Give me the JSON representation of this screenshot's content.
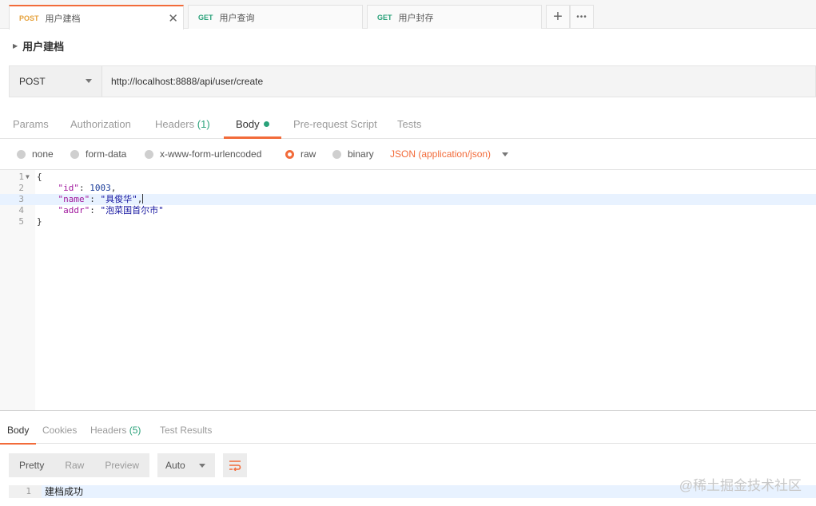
{
  "tabs": [
    {
      "method": "POST",
      "name": "用户建档"
    },
    {
      "method": "GET",
      "name": "用户查询"
    },
    {
      "method": "GET",
      "name": "用户封存"
    }
  ],
  "tab_actions": {
    "add": "+",
    "more": "•••",
    "close": "✕"
  },
  "request": {
    "name": "用户建档",
    "method": "POST",
    "url": "http://localhost:8888/api/user/create"
  },
  "request_tabs": {
    "params": "Params",
    "authorization": "Authorization",
    "headers": "Headers",
    "headers_count": "(1)",
    "body": "Body",
    "pre_request": "Pre-request Script",
    "tests": "Tests"
  },
  "body_types": {
    "none": "none",
    "form_data": "form-data",
    "urlencoded": "x-www-form-urlencoded",
    "raw": "raw",
    "binary": "binary",
    "selected": "raw",
    "content_type": "JSON (application/json)"
  },
  "editor": {
    "line_numbers": [
      "1",
      "2",
      "3",
      "4",
      "5"
    ],
    "open_brace": "{",
    "close_brace": "}",
    "fields": [
      {
        "key": "\"id\"",
        "value": "1003",
        "suffix": ","
      },
      {
        "key": "\"name\"",
        "value": "\"具俊华\"",
        "suffix": ","
      },
      {
        "key": "\"addr\"",
        "value": "\"泡菜国首尔市\"",
        "suffix": ""
      }
    ]
  },
  "response_tabs": {
    "body": "Body",
    "cookies": "Cookies",
    "headers": "Headers",
    "headers_count": "(5)",
    "test_results": "Test Results"
  },
  "response_toolbar": {
    "pretty": "Pretty",
    "raw": "Raw",
    "preview": "Preview",
    "format": "Auto"
  },
  "response_body": {
    "line": "1",
    "text": "建档成功"
  },
  "watermark": "@稀土掘金技术社区",
  "colors": {
    "accent": "#f26b3a",
    "get": "#2aa27a",
    "post": "#e6a23c"
  }
}
